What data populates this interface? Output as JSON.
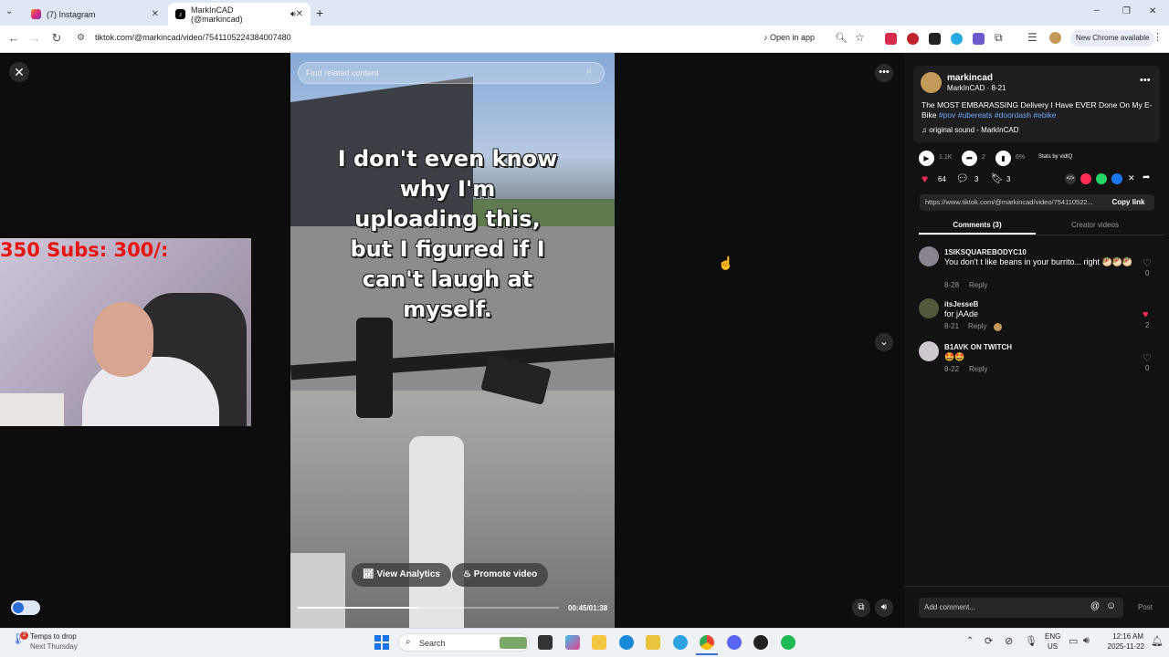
{
  "browser": {
    "tabs": [
      {
        "label": "(7) Instagram",
        "active": false
      },
      {
        "label": "MarkInCAD (@markincad)",
        "active": true
      }
    ],
    "new_tab": "+",
    "url": "tiktok.com/@markincad/video/7541105224384007480",
    "open_in_app": "Open in app",
    "new_chrome": "New Chrome available",
    "window_controls": [
      "–",
      "❐",
      "✕"
    ]
  },
  "video": {
    "search_placeholder": "Find related content",
    "caption_lines": [
      "I don't even know",
      "why I'm",
      "uploading this,",
      "but I figured if I",
      "can't laugh at",
      "myself."
    ],
    "view_analytics": "View Analytics",
    "promote_video": "Promote video",
    "time": "00:45/01:38",
    "progress": 0.46
  },
  "webcam": {
    "overlay_text": "350  Subs: 300/:"
  },
  "post": {
    "username": "markincad",
    "handle_date": "MarkInCAD · 8-21",
    "description": "The MOST EMBARASSING Delivery I Have EVER Done On My E-Bike",
    "hashtags": "#pov #ubereats #doordash #ebike",
    "sound": "original sound - MarkInCAD",
    "plays": "1.1K",
    "shares_top": "2",
    "stat3": "6%",
    "stats_by": "Stats by vidIQ",
    "likes": "64",
    "comments": "3",
    "saves": "3",
    "link": "https://www.tiktok.com/@markincad/video/754110522...",
    "copy_link": "Copy link",
    "tab_comments": "Comments (3)",
    "tab_creator": "Creator videos"
  },
  "comments": [
    {
      "name": "1SIKSQUAREBODYC10",
      "text": "You don't t like beans in your burrito... right 🥙🥙🥙",
      "date": "8-28",
      "reply": "Reply",
      "likes": "0",
      "liked": false
    },
    {
      "name": "itsJesseB",
      "text": "for jAAde",
      "date": "8-21",
      "reply": "Reply",
      "likes": "2",
      "liked": true
    },
    {
      "name": "B1AVK ON TWITCH",
      "text": "🤩🤩",
      "date": "8-22",
      "reply": "Reply",
      "likes": "0",
      "liked": false
    }
  ],
  "comment_input": {
    "placeholder": "Add comment...",
    "post": "Post"
  },
  "taskbar": {
    "weather_title": "Temps to drop",
    "weather_sub": "Next Thursday",
    "search": "Search",
    "lang1": "ENG",
    "lang2": "US",
    "time": "12:16 AM",
    "date": "2025-11-22"
  },
  "colors": {
    "accent": "#fe2c55",
    "link": "#6fa8ff"
  }
}
